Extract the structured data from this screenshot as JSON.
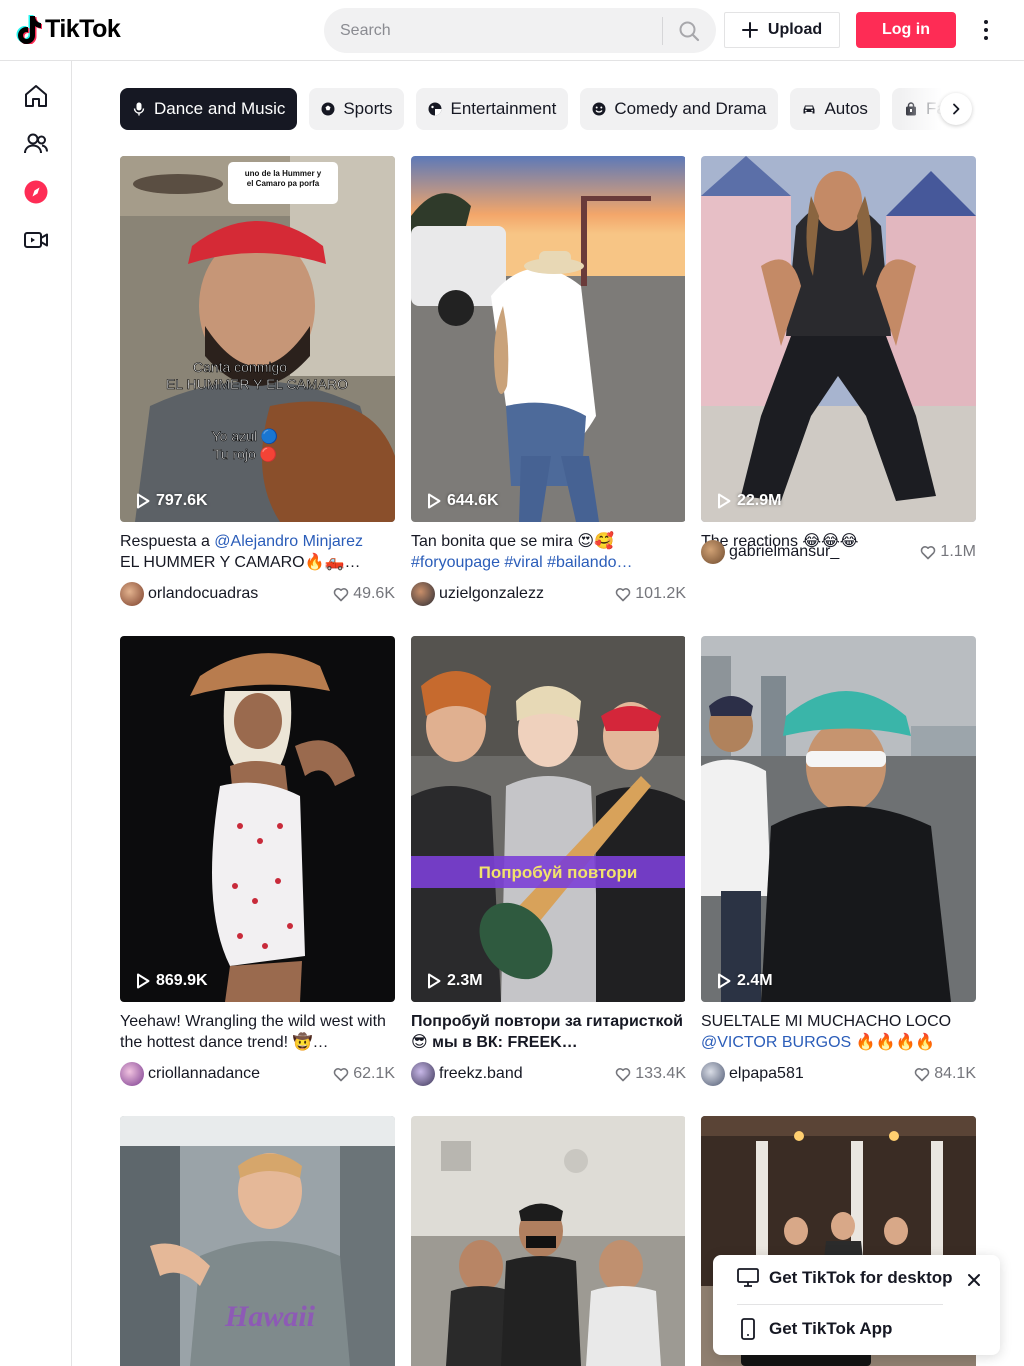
{
  "header": {
    "logo_text": "TikTok",
    "search_placeholder": "Search",
    "upload_label": "Upload",
    "login_label": "Log in"
  },
  "sidebar": {
    "items": [
      {
        "icon": "home-icon"
      },
      {
        "icon": "following-icon"
      },
      {
        "icon": "explore-icon",
        "color": "#fe2c55"
      },
      {
        "icon": "live-icon"
      }
    ]
  },
  "categories": [
    {
      "label": "Dance and Music",
      "active": true
    },
    {
      "label": "Sports"
    },
    {
      "label": "Entertainment"
    },
    {
      "label": "Comedy and Drama"
    },
    {
      "label": "Autos"
    },
    {
      "label": "Fa"
    }
  ],
  "videos": [
    {
      "views": "797.6K",
      "caption_plain": "Respuesta a ",
      "caption_tag": "@Alejandro Minjarez",
      "caption_line2": "EL HUMMER Y CAMARO🔥🛻…",
      "username": "orlandocuadras",
      "likes": "49.6K"
    },
    {
      "views": "644.6K",
      "caption_plain": "Tan bonita que se mira 😍🥰",
      "caption_tag": "",
      "caption_line2": "#foryoupage #viral #bailando…",
      "username": "uzielgonzalezz",
      "likes": "101.2K"
    },
    {
      "views": "22.9M",
      "caption_plain": "The reactions 😂😂😂",
      "caption_tag": "",
      "caption_line2": "",
      "username": "gabrielmansur_",
      "likes": "1.1M"
    },
    {
      "views": "869.9K",
      "caption_plain": "Yeehaw! Wrangling the wild west with the hottest dance trend! 🤠…",
      "caption_tag": "",
      "caption_line2": "",
      "username": "criollannadance",
      "likes": "62.1K"
    },
    {
      "views": "2.3M",
      "caption_plain": "Попробуй повтори за гитаристкой😎 мы в ВК: FREEK…",
      "caption_tag": "",
      "caption_line2": "",
      "username": "freekz.band",
      "likes": "133.4K"
    },
    {
      "views": "2.4M",
      "caption_plain": "SUELTALE MI MUCHACHO LOCO",
      "caption_tag": "@VICTOR BURGOS",
      "caption_line2": "🔥🔥🔥🔥",
      "username": "elpapa581",
      "likes": "84.1K"
    },
    {
      "views": "",
      "caption_plain": "",
      "caption_tag": "",
      "caption_line2": "",
      "username": "",
      "likes": ""
    },
    {
      "views": "",
      "caption_plain": "",
      "caption_tag": "",
      "caption_line2": "",
      "username": "",
      "likes": ""
    },
    {
      "views": "",
      "caption_plain": "",
      "caption_tag": "",
      "caption_line2": "",
      "username": "",
      "likes": ""
    }
  ],
  "overlays": {
    "v1_bubble_line1": "uno de la Hummer y",
    "v1_bubble_line2": "el Camaro pa porfa",
    "v1_text1": "Canta conmigo",
    "v1_text2": "EL HUMMER Y EL CAMARO",
    "v1_text3": "Yo azul 🔵",
    "v1_text4": "Tu rojo 🔴",
    "v5_banner": "Попробуй повтори"
  },
  "popup": {
    "desktop_label": "Get TikTok for desktop",
    "app_label": "Get TikTok App"
  },
  "colors": {
    "brand": "#fe2c55",
    "hashtag": "#2b5db9",
    "text": "#161823"
  }
}
